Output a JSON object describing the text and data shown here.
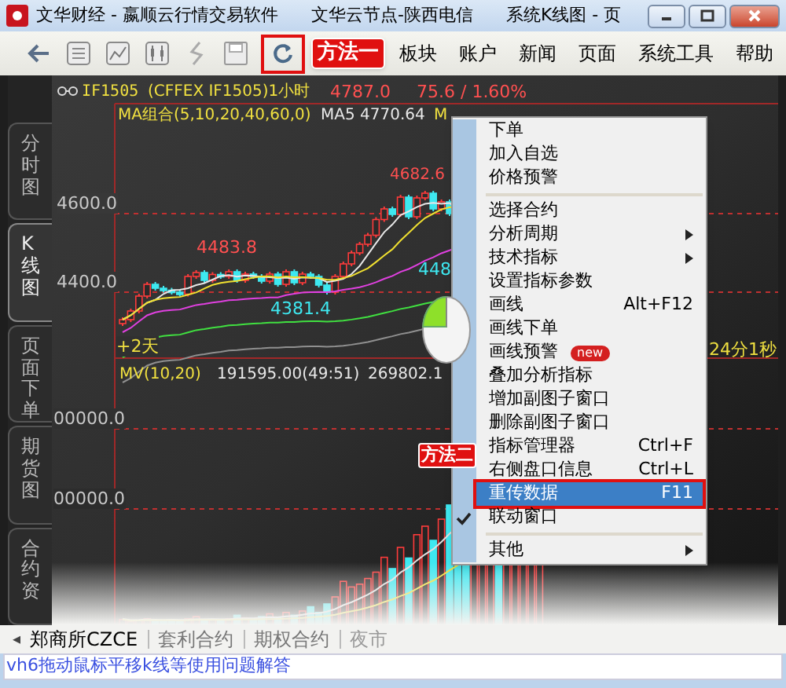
{
  "window": {
    "title": "文华财经 - 嬴顺云行情交易软件",
    "node": "文华云节点-陕西电信",
    "page": "系统K线图 - 页"
  },
  "toolbar": {
    "annotation": "方法一",
    "menu": [
      "板块",
      "账户",
      "新闻",
      "页面",
      "系统工具",
      "帮助"
    ]
  },
  "side_tabs": [
    {
      "label": "分时图",
      "selected": false
    },
    {
      "label": "K线图",
      "selected": true
    },
    {
      "label": "页面下单",
      "selected": false
    },
    {
      "label": "期货图",
      "selected": false
    },
    {
      "label": "合约资",
      "selected": false
    }
  ],
  "chart": {
    "symbol": "IF1505",
    "description": "(CFFEX IF1505)1小时",
    "last": "4787.0",
    "change": "75.6 / 1.60%",
    "ma_label": "MA组合(5,10,20,40,60,0)",
    "ma5": "MA5 4770.64",
    "ma_cut": "M",
    "price_ticks": [
      "4600.0",
      "4400.0"
    ],
    "high_label": "4682.6",
    "mid_label": "4483.8",
    "low_label": "4381.4",
    "cut_label": "448",
    "days_label": "+2天",
    "volume_label": "MV(10,20)",
    "volume_value": "191595.00(49:51)",
    "volume_cut": "269802.1",
    "volume_ticks": [
      "00000.0",
      "00000.0"
    ],
    "timer": "24分1秒"
  },
  "context_menu": {
    "annotation": "方法二",
    "items": [
      {
        "kind": "item",
        "label": "下单",
        "selected": false,
        "checked": false
      },
      {
        "kind": "item",
        "label": "加入自选",
        "selected": false,
        "checked": false
      },
      {
        "kind": "item",
        "label": "价格预警",
        "selected": false,
        "checked": false
      },
      {
        "kind": "separator"
      },
      {
        "kind": "item",
        "label": "选择合约",
        "selected": false,
        "checked": false
      },
      {
        "kind": "submenu",
        "label": "分析周期",
        "selected": false,
        "checked": false
      },
      {
        "kind": "submenu",
        "label": "技术指标",
        "selected": false,
        "checked": false
      },
      {
        "kind": "item",
        "label": "设置指标参数",
        "selected": false,
        "checked": false
      },
      {
        "kind": "item",
        "label": "画线",
        "shortcut": "Alt+F12",
        "selected": false,
        "checked": false
      },
      {
        "kind": "item",
        "label": "画线下单",
        "selected": false,
        "checked": false
      },
      {
        "kind": "item",
        "label": "画线预警",
        "badge": "new",
        "selected": false,
        "checked": false
      },
      {
        "kind": "item",
        "label": "叠加分析指标",
        "selected": false,
        "checked": false
      },
      {
        "kind": "item",
        "label": "增加副图子窗口",
        "selected": false,
        "checked": false
      },
      {
        "kind": "item",
        "label": "删除副图子窗口",
        "selected": false,
        "checked": false
      },
      {
        "kind": "item",
        "label": "指标管理器",
        "shortcut": "Ctrl+F",
        "selected": false,
        "checked": false
      },
      {
        "kind": "item",
        "label": "右侧盘口信息",
        "shortcut": "Ctrl+L",
        "selected": false,
        "checked": false
      },
      {
        "kind": "item",
        "label": "重传数据",
        "shortcut": "F11",
        "selected": true,
        "checked": false
      },
      {
        "kind": "item",
        "label": "联动窗口",
        "selected": false,
        "checked": true
      },
      {
        "kind": "separator"
      },
      {
        "kind": "submenu",
        "label": "其他",
        "selected": false,
        "checked": false
      }
    ]
  },
  "bottom_tabs": [
    {
      "label": "郑商所CZCE",
      "selected": true
    },
    {
      "label": "套利合约",
      "selected": false
    },
    {
      "label": "期权合约",
      "selected": false
    },
    {
      "label": "夜市",
      "selected": false
    }
  ],
  "bottom_scroll": "◂",
  "status_bar": "vh6拖动鼠标平移k线等使用问题解答"
}
